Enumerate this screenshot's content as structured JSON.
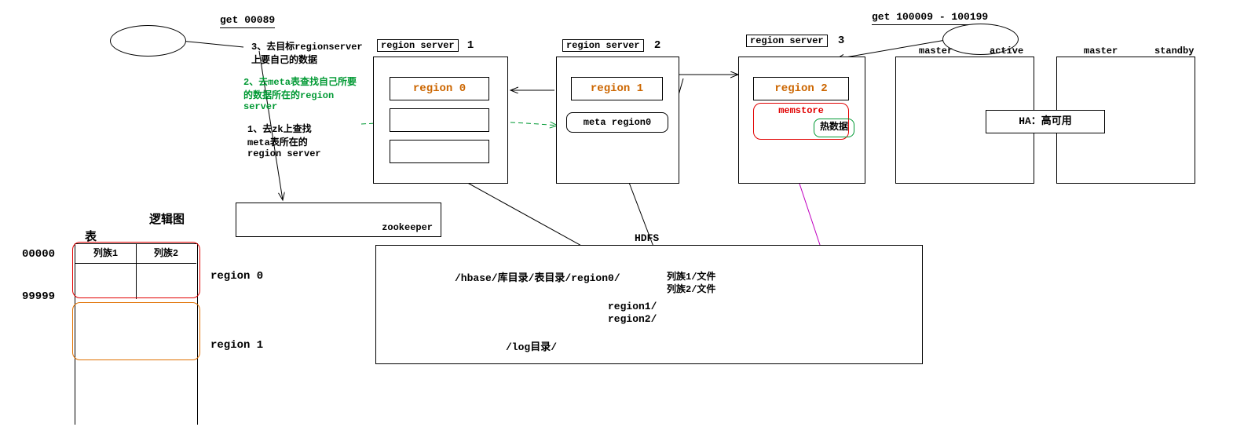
{
  "queries": {
    "q1": "get 00089",
    "q2": "get 100009 - 100199"
  },
  "steps": {
    "s3": "3、去目标regionserver\n上要自己的数据",
    "s2": "2、去meta表查找自己所要\n的数据所在的region\nserver",
    "s1": "1、去zk上查找\nmeta表所在的\nregion server"
  },
  "servers": {
    "rs_label": "region server",
    "rs1_num": "1",
    "rs2_num": "2",
    "rs3_num": "3",
    "region0": "region 0",
    "region1": "region 1",
    "region2": "region 2",
    "meta_region": "meta region0",
    "memstore": "memstore",
    "hotdata": "热数据"
  },
  "master": {
    "label": "master",
    "active": "active",
    "standby": "standby",
    "ha": "HA：高可用"
  },
  "zookeeper": "zookeeper",
  "hdfs": {
    "title": "HDFS",
    "path": "/hbase/库目录/表目录/region0/",
    "cf1": "列族1/文件",
    "cf2": "列族2/文件",
    "r1": "region1/",
    "r2": "region2/",
    "log": "/log目录/"
  },
  "logical": {
    "title": "逻辑图",
    "table": "表",
    "cf1": "列族1",
    "cf2": "列族2",
    "rowkey_start": "00000",
    "rowkey_end": "99999",
    "r0": "region 0",
    "r1": "region 1"
  }
}
